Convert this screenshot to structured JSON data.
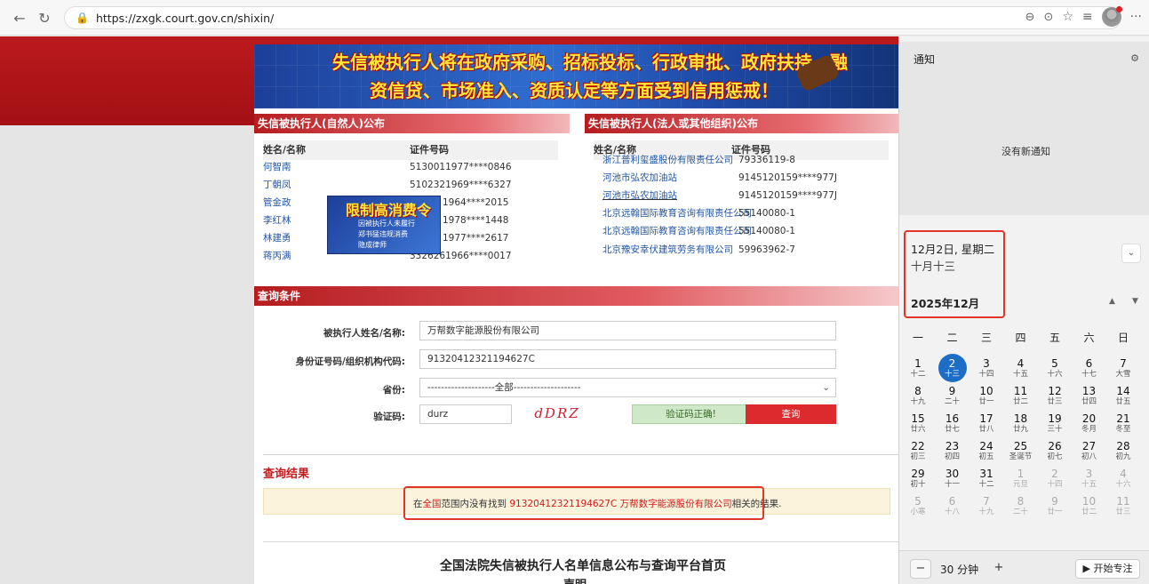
{
  "browser": {
    "url": "https://zxgk.court.gov.cn/shixin/"
  },
  "banner": {
    "line1": "失信被执行人将在政府采购、招标投标、行政审批、政府扶持、融",
    "line2": "资信贷、市场准入、资质认定等方面受到信用惩戒！"
  },
  "natural": {
    "title": "失信被执行人(自然人)公布",
    "col_name": "姓名/名称",
    "col_id": "证件号码",
    "rows": [
      {
        "name": "何智南",
        "id": "5130011977****0846"
      },
      {
        "name": "丁朝凤",
        "id": "5102321969****6327"
      },
      {
        "name": "管金政",
        "id": "1964****2015"
      },
      {
        "name": "李红林",
        "id": "1978****1448"
      },
      {
        "name": "林建勇",
        "id": "1977****2617"
      },
      {
        "name": "蒋丙满",
        "id": "3326261966****0017"
      }
    ]
  },
  "ad": {
    "title": "限制高消费令",
    "line1": "因被执行人未履行",
    "line2": "郑书猛违规消费",
    "line3": "隐成律师"
  },
  "legal": {
    "title": "失信被执行人(法人或其他组织)公布",
    "col_name": "姓名/名称",
    "col_id": "证件号码",
    "rows": [
      {
        "name": "浙江普利玺盛股份有限责任公司",
        "id": "79336119-8"
      },
      {
        "name": "河池市弘农加油站",
        "id": "9145120159****977J"
      },
      {
        "name": "河池市弘农加油站",
        "id": "9145120159****977J"
      },
      {
        "name": "北京远翰国际教育咨询有限责任公司",
        "id": "55140080-1"
      },
      {
        "name": "北京远翰国际教育咨询有限责任公司",
        "id": "55140080-1"
      },
      {
        "name": "北京豫安幸伏建筑劳务有限公司",
        "id": "59963962-7"
      }
    ]
  },
  "query": {
    "title": "查询条件",
    "name_label": "被执行人姓名/名称:",
    "name_value": "万帮数字能源股份有限公司",
    "id_label": "身份证号码/组织机构代码:",
    "id_value": "91320412321194627C",
    "province_label": "省份:",
    "province_value": "--------------------全部--------------------",
    "captcha_label": "验证码:",
    "captcha_value": "durz",
    "captcha_image": "dDRZ",
    "captcha_ok": "验证码正确!",
    "search_button": "查询"
  },
  "result": {
    "title": "查询结果",
    "prefix": "在",
    "scope": "全国",
    "mid": "范围内没有找到",
    "keyword": "91320412321194627C 万帮数字能源股份有限公司",
    "suffix": "相关的结果."
  },
  "footer": {
    "title": "全国法院失信被执行人名单信息公布与查询平台首页",
    "sub": "声明"
  },
  "panel": {
    "notif_title": "通知",
    "notif_empty": "没有新通知",
    "date": "12月2日, 星期二",
    "lunar": "十月十三",
    "month": "2025年12月",
    "weekdays": [
      "一",
      "二",
      "三",
      "四",
      "五",
      "六",
      "日"
    ],
    "days": [
      {
        "n": "1",
        "l": "十二"
      },
      {
        "n": "2",
        "l": "十三",
        "today": true
      },
      {
        "n": "3",
        "l": "十四"
      },
      {
        "n": "4",
        "l": "十五"
      },
      {
        "n": "5",
        "l": "十六"
      },
      {
        "n": "6",
        "l": "十七"
      },
      {
        "n": "7",
        "l": "大雪"
      },
      {
        "n": "8",
        "l": "十九"
      },
      {
        "n": "9",
        "l": "二十"
      },
      {
        "n": "10",
        "l": "廿一"
      },
      {
        "n": "11",
        "l": "廿二"
      },
      {
        "n": "12",
        "l": "廿三"
      },
      {
        "n": "13",
        "l": "廿四"
      },
      {
        "n": "14",
        "l": "廿五"
      },
      {
        "n": "15",
        "l": "廿六"
      },
      {
        "n": "16",
        "l": "廿七"
      },
      {
        "n": "17",
        "l": "廿八"
      },
      {
        "n": "18",
        "l": "廿九"
      },
      {
        "n": "19",
        "l": "三十"
      },
      {
        "n": "20",
        "l": "冬月"
      },
      {
        "n": "21",
        "l": "冬至"
      },
      {
        "n": "22",
        "l": "初三"
      },
      {
        "n": "23",
        "l": "初四"
      },
      {
        "n": "24",
        "l": "初五"
      },
      {
        "n": "25",
        "l": "圣诞节"
      },
      {
        "n": "26",
        "l": "初七"
      },
      {
        "n": "27",
        "l": "初八"
      },
      {
        "n": "28",
        "l": "初九"
      },
      {
        "n": "29",
        "l": "初十"
      },
      {
        "n": "30",
        "l": "十一"
      },
      {
        "n": "31",
        "l": "十二"
      },
      {
        "n": "1",
        "l": "元旦",
        "other": true
      },
      {
        "n": "2",
        "l": "十四",
        "other": true
      },
      {
        "n": "3",
        "l": "十五",
        "other": true
      },
      {
        "n": "4",
        "l": "十六",
        "other": true
      },
      {
        "n": "5",
        "l": "小寒",
        "other": true
      },
      {
        "n": "6",
        "l": "十八",
        "other": true
      },
      {
        "n": "7",
        "l": "十九",
        "other": true
      },
      {
        "n": "8",
        "l": "二十",
        "other": true
      },
      {
        "n": "9",
        "l": "廿一",
        "other": true
      },
      {
        "n": "10",
        "l": "廿二",
        "other": true
      },
      {
        "n": "11",
        "l": "廿三",
        "other": true
      }
    ],
    "focus_minus": "−",
    "focus_plus": "+",
    "focus_value": "30 分钟",
    "focus_start": "▶ 开始专注"
  }
}
